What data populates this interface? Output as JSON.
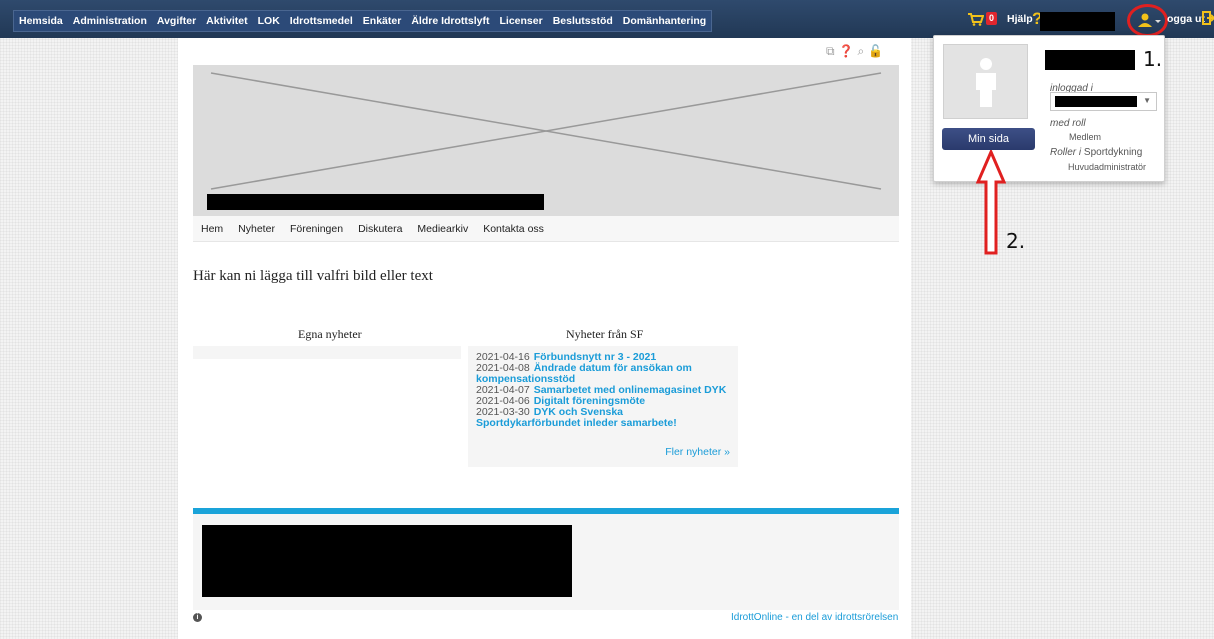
{
  "topnav": {
    "items": [
      {
        "label": "Hemsida",
        "name": "nav-hemsida"
      },
      {
        "label": "Administration",
        "name": "nav-administration"
      },
      {
        "label": "Avgifter",
        "name": "nav-avgifter"
      },
      {
        "label": "Aktivitet",
        "name": "nav-aktivitet"
      },
      {
        "label": "LOK",
        "name": "nav-lok"
      },
      {
        "label": "Idrottsmedel",
        "name": "nav-idrottsmedel"
      },
      {
        "label": "Enkäter",
        "name": "nav-enkater"
      },
      {
        "label": "Äldre Idrottslyft",
        "name": "nav-aldre-idrottslyft"
      },
      {
        "label": "Licenser",
        "name": "nav-licenser"
      },
      {
        "label": "Beslutsstöd",
        "name": "nav-beslutsstod"
      },
      {
        "label": "Domänhantering",
        "name": "nav-domanhantering"
      }
    ],
    "cart_count": "0",
    "help_label": "Hjälp",
    "help_icon": "?",
    "logout_label": "ogga ut"
  },
  "subnav": {
    "items": [
      {
        "label": "Hem",
        "name": "subnav-hem"
      },
      {
        "label": "Nyheter",
        "name": "subnav-nyheter"
      },
      {
        "label": "Föreningen",
        "name": "subnav-foreningen"
      },
      {
        "label": "Diskutera",
        "name": "subnav-diskutera"
      },
      {
        "label": "Mediearkiv",
        "name": "subnav-mediearkiv"
      },
      {
        "label": "Kontakta oss",
        "name": "subnav-kontakta-oss"
      }
    ]
  },
  "main": {
    "intro_text": "Här kan ni lägga till valfri bild eller text",
    "egna_title": "Egna nyheter",
    "sf_title": "Nyheter från SF",
    "news": [
      {
        "date": "2021-04-16",
        "title": "Förbundsnytt nr 3 - 2021"
      },
      {
        "date": "2021-04-08",
        "title": "Ändrade datum för ansökan om kompensationsstöd"
      },
      {
        "date": "2021-04-07",
        "title": "Samarbetet med onlinemagasinet DYK"
      },
      {
        "date": "2021-04-06",
        "title": "Digitalt föreningsmöte"
      },
      {
        "date": "2021-03-30",
        "title": "DYK och Svenska Sportdykarförbundet inleder samarbete!"
      }
    ],
    "more_news": "Fler nyheter »",
    "footer_link": "IdrottOnline - en del av idrottsrörelsen"
  },
  "dropdown": {
    "logged_in_label": "inloggad i",
    "role_label": "med roll",
    "role_value": "Medlem",
    "roles_prefix": "Roller",
    "roles_in": "i",
    "roles_org": "Sportdykning",
    "roles_value": "Huvudadministratör",
    "my_page_button": "Min sida"
  },
  "annotations": {
    "step1": "1.",
    "step2": "2."
  },
  "colors": {
    "topbar": "#2f4a6d",
    "link": "#1a9cd8",
    "annotation": "#e02020",
    "accent_rule": "#1aa3d9"
  }
}
